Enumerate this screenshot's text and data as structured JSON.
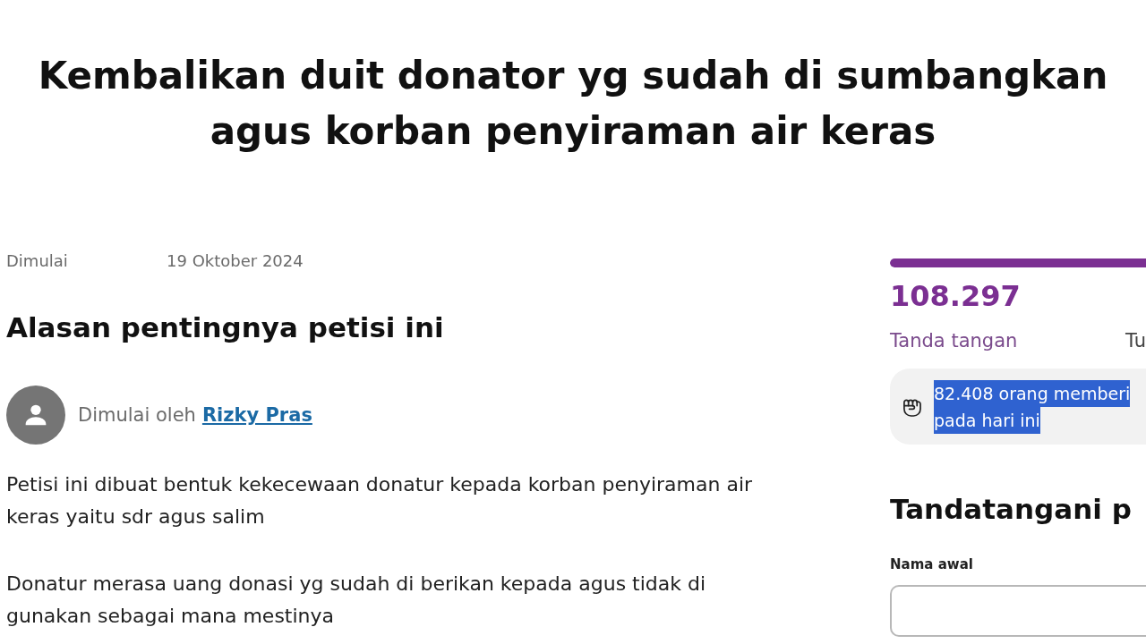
{
  "header": {
    "title_lines": [
      "Kembalikan duit donator yg sudah di sumbangkan",
      "agus korban penyiraman air keras"
    ]
  },
  "details": {
    "started_label": "Dimulai",
    "started_date": "19 Oktober 2024"
  },
  "reason": {
    "heading": "Alasan pentingnya petisi ini",
    "starter_prefix": "Dimulai oleh",
    "starter_name": "Rizky Pras",
    "paragraphs": [
      "Petisi ini dibuat bentuk kekecewaan donatur kepada korban penyiraman air keras yaitu sdr agus salim",
      "Donatur merasa uang donasi yg sudah di berikan kepada agus tidak di gunakan sebagai mana mestinya"
    ]
  },
  "sidebar": {
    "progress": {
      "level": 1
    },
    "signature_count": "108.297",
    "signature_label": "Tanda tangan",
    "goal_label": "Tu",
    "activity": {
      "lines": [
        "82.408 orang memberi",
        "pada hari ini"
      ],
      "highlighted": true
    },
    "sign_heading": "Tandatangani p",
    "first_name_field": {
      "label": "Nama awal"
    }
  }
}
